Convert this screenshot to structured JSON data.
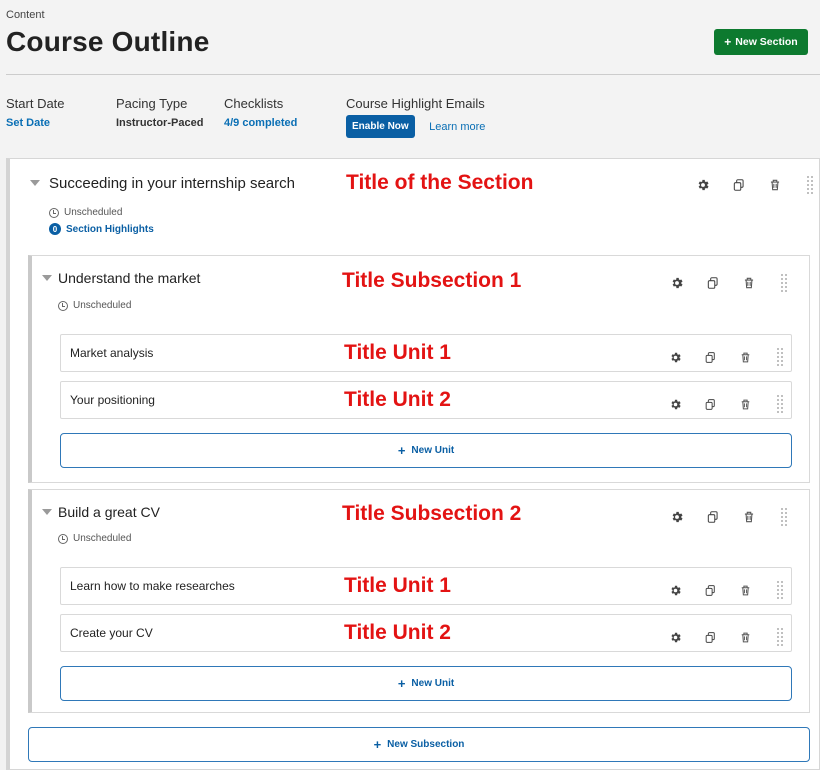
{
  "header": {
    "faded_text": "",
    "breadcrumb": "Content",
    "title": "Course Outline",
    "new_section_label": "New Section"
  },
  "meta": {
    "start_date": {
      "label": "Start Date",
      "value": "Set Date"
    },
    "pacing": {
      "label": "Pacing Type",
      "value": "Instructor-Paced"
    },
    "checklists": {
      "label": "Checklists",
      "value": "4/9 completed"
    },
    "emails": {
      "label": "Course Highlight Emails",
      "enable_label": "Enable Now",
      "learn_label": "Learn more"
    }
  },
  "section": {
    "title": "Succeeding in your internship search",
    "annotation": "Title of the Section",
    "schedule": "Unscheduled",
    "highlights_count": "0",
    "highlights_label": "Section Highlights",
    "subsections": [
      {
        "title": "Understand the market",
        "annotation": "Title Subsection 1",
        "schedule": "Unscheduled",
        "units": [
          {
            "title": "Market analysis",
            "annotation": "Title Unit 1"
          },
          {
            "title": "Your positioning",
            "annotation": "Title Unit 2"
          }
        ],
        "new_unit_label": "New Unit"
      },
      {
        "title": "Build a great CV",
        "annotation": "Title Subsection 2",
        "schedule": "Unscheduled",
        "units": [
          {
            "title": "Learn how to make researches",
            "annotation": "Title Unit 1"
          },
          {
            "title": "Create your CV",
            "annotation": "Title Unit 2"
          }
        ],
        "new_unit_label": "New Unit"
      }
    ],
    "new_subsection_label": "New Subsection"
  },
  "icons": {
    "settings": "gear-icon",
    "duplicate": "copy-icon",
    "delete": "trash-icon",
    "drag": "drag-handle-icon",
    "collapse": "caret-down-icon",
    "schedule": "clock-icon",
    "add": "plus-icon"
  },
  "colors": {
    "primary": "#0a5fa4",
    "success": "#0d7a2f",
    "annotation": "#e31313",
    "link": "#0a6fb5"
  }
}
